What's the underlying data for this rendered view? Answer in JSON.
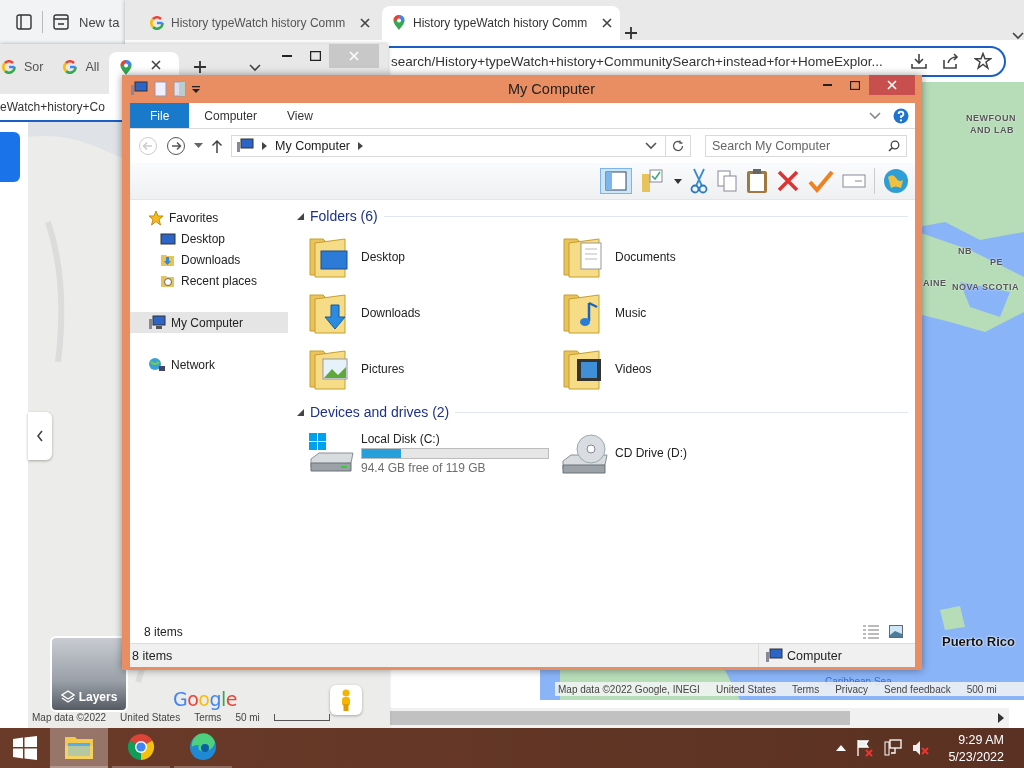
{
  "back_window": {
    "tab_title": "New ta"
  },
  "browser": {
    "tabs": [
      {
        "title": "History typeWatch history Comm",
        "kind": "google",
        "selected": false
      },
      {
        "title": "History typeWatch history Comm",
        "kind": "maps",
        "selected": true
      }
    ],
    "url": "search/History+typeWatch+history+CommunitySearch+instead+for+HomeExplor...",
    "map": {
      "labels": [
        {
          "text": "NEWFOUN",
          "kind": "region"
        },
        {
          "text": "AND LAB",
          "kind": "region"
        },
        {
          "text": "NB",
          "kind": "region"
        },
        {
          "text": "PE",
          "kind": "region"
        },
        {
          "text": "AINE",
          "kind": "region"
        },
        {
          "text": "NOVA SCOTIA",
          "kind": "region"
        },
        {
          "text": "Puerto Rico",
          "kind": "country"
        },
        {
          "text": "Caribbean Sea",
          "kind": "water"
        }
      ],
      "footer": [
        "Map data ©2022 Google, INEGI",
        "United States",
        "Terms",
        "Privacy",
        "Send feedback",
        "500 mi"
      ]
    }
  },
  "maps_window": {
    "tabs": [
      {
        "title": "Sor",
        "kind": "google",
        "selected": false
      },
      {
        "title": "All",
        "kind": "google",
        "selected": false
      },
      {
        "kind": "maps",
        "selected": true
      }
    ],
    "url": "eWatch+history+Co",
    "layers": "Layers",
    "logo": "Google",
    "footer": [
      "Map data ©2022",
      "United States",
      "Terms",
      "50 mi"
    ]
  },
  "explorer": {
    "title": "My Computer",
    "ribbon_tabs": [
      {
        "label": "File",
        "selected": true
      },
      {
        "label": "Computer",
        "selected": false
      },
      {
        "label": "View",
        "selected": false
      }
    ],
    "address": "My Computer",
    "search_placeholder": "Search My Computer",
    "nav": [
      {
        "label": "Favorites",
        "kind": "star",
        "selected": false,
        "children": [
          {
            "label": "Desktop",
            "kind": "desktop",
            "selected": false
          },
          {
            "label": "Downloads",
            "kind": "downloads",
            "selected": false
          },
          {
            "label": "Recent places",
            "kind": "recent",
            "selected": false
          }
        ]
      },
      {
        "label": "My Computer",
        "kind": "computer",
        "selected": true
      },
      {
        "label": "Network",
        "kind": "network",
        "selected": false
      }
    ],
    "groups": [
      {
        "title": "Folders (6)",
        "items": [
          {
            "name": "Desktop",
            "kind": "desktop"
          },
          {
            "name": "Documents",
            "kind": "documents"
          },
          {
            "name": "Downloads",
            "kind": "downloads"
          },
          {
            "name": "Music",
            "kind": "music"
          },
          {
            "name": "Pictures",
            "kind": "pictures"
          },
          {
            "name": "Videos",
            "kind": "videos"
          }
        ]
      },
      {
        "title": "Devices and drives (2)",
        "items": [
          {
            "name": "Local Disk (C:)",
            "kind": "disk",
            "level": 0.21,
            "free": "94.4 GB free of 119 GB"
          },
          {
            "name": "CD Drive (D:)",
            "kind": "cd"
          }
        ]
      }
    ],
    "item_count": "8 items",
    "status": {
      "count": "8 items",
      "location": "Computer"
    }
  },
  "taskbar": {
    "apps": [
      {
        "kind": "explorer",
        "selected": true
      },
      {
        "kind": "chrome",
        "selected": false
      },
      {
        "kind": "edge",
        "selected": false
      }
    ],
    "time": "9:29 AM",
    "date": "5/23/2022"
  }
}
